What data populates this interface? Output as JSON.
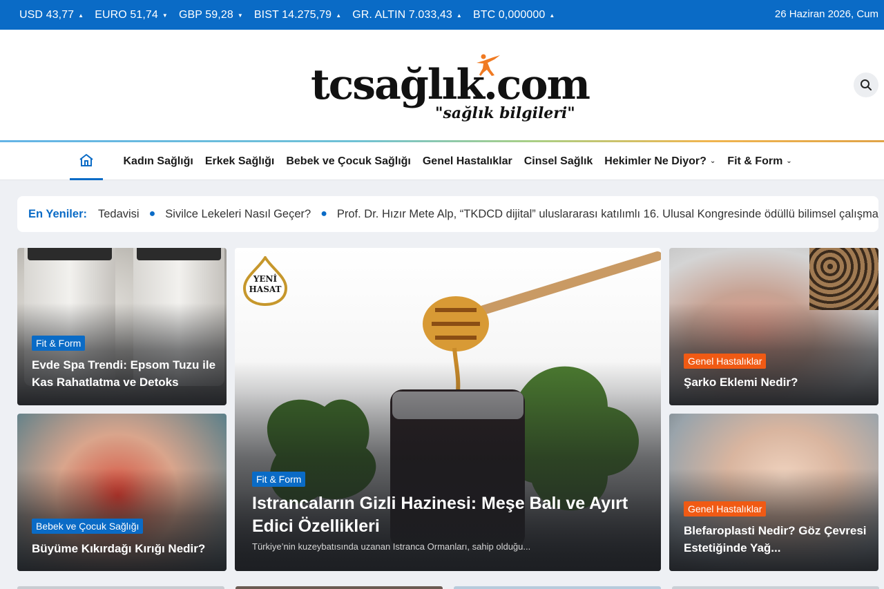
{
  "tickers": [
    {
      "label": "USD 43,77",
      "trend": "up"
    },
    {
      "label": "EURO 51,74",
      "trend": "down"
    },
    {
      "label": "GBP 59,28",
      "trend": "down"
    },
    {
      "label": "BIST 14.275,79",
      "trend": "up"
    },
    {
      "label": "GR. ALTIN 7.033,43",
      "trend": "up"
    },
    {
      "label": "BTC 0,000000",
      "trend": "up"
    }
  ],
  "top_date": "26 Haziran 2026, Cum",
  "logo": {
    "main": "tcsağlık.com",
    "sub": "\"sağlık bilgileri\""
  },
  "nav": {
    "items": [
      {
        "label": "Kadın Sağlığı",
        "dropdown": false
      },
      {
        "label": "Erkek Sağlığı",
        "dropdown": false
      },
      {
        "label": "Bebek ve Çocuk Sağlığı",
        "dropdown": false
      },
      {
        "label": "Genel Hastalıklar",
        "dropdown": false
      },
      {
        "label": "Cinsel Sağlık",
        "dropdown": false
      },
      {
        "label": "Hekimler Ne Diyor?",
        "dropdown": true
      },
      {
        "label": "Fit & Form",
        "dropdown": true
      }
    ]
  },
  "news_ticker": {
    "label": "En Yeniler:",
    "items": [
      "Tedavisi",
      "Sivilce Lekeleri Nasıl Geçer?",
      "Prof. Dr. Hızır Mete Alp, “TKDCD dijital” uluslararası katılımlı 16. Ulusal Kongresinde ödüllü bilimsel çalışmalar"
    ]
  },
  "cards": {
    "spa": {
      "category": "Fit & Form",
      "title": "Evde Spa Trendi: Epsom Tuzu ile Kas Rahatlatma ve Detoks"
    },
    "knee": {
      "category": "Bebek ve Çocuk Sağlığı",
      "title": "Büyüme Kıkırdağı Kırığı Nedir?"
    },
    "honey": {
      "category": "Fit & Form",
      "title": "Istrancaların Gizli Hazinesi: Meşe Balı ve Ayırt Edici Özellikleri",
      "excerpt": "Türkiye’nin kuzeybatısında uzanan Istranca Ormanları, sahip olduğu...",
      "badge_line1": "YENİ",
      "badge_line2": "HASAT"
    },
    "ankle": {
      "category": "Genel Hastalıklar",
      "title": "Şarko Eklemi Nedir?"
    },
    "eye": {
      "category": "Genel Hastalıklar",
      "title": "Blefaroplasti Nedir? Göz Çevresi Estetiğinde Yağ..."
    }
  },
  "colors": {
    "brand_blue": "#0a6bc6",
    "accent_orange": "#f05a14"
  }
}
